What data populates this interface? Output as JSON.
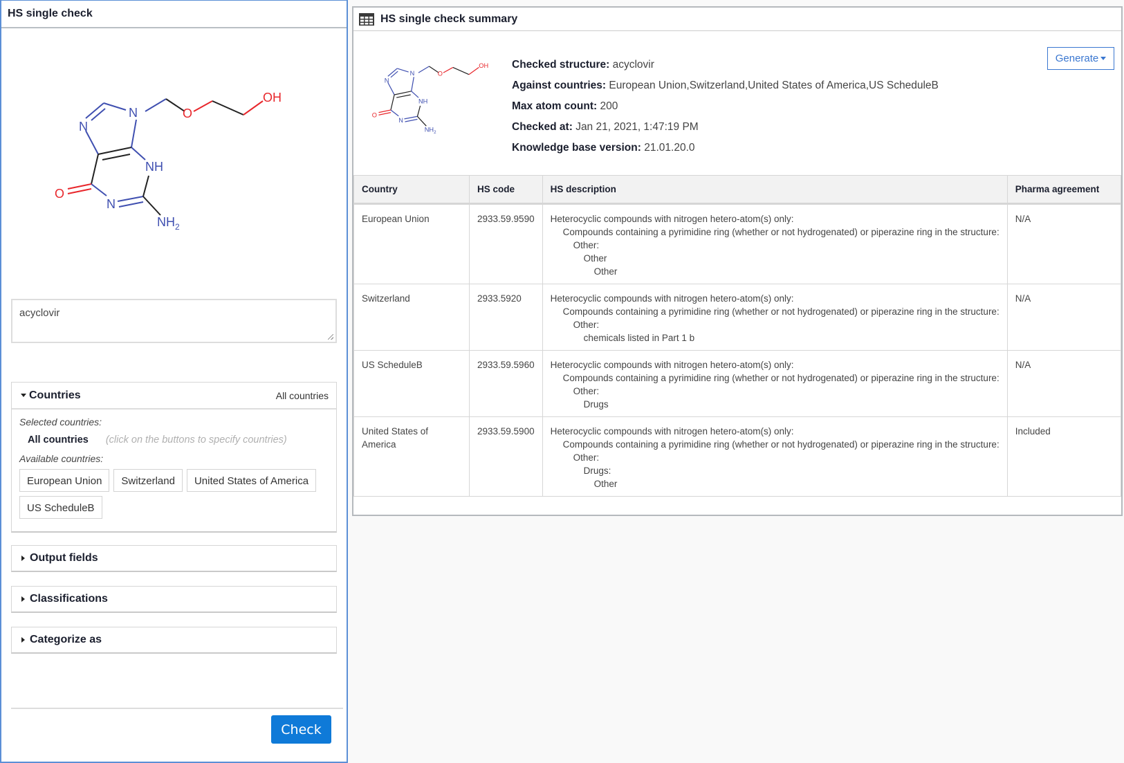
{
  "left_panel": {
    "title": "HS single check",
    "structure_name_input": "acyclovir",
    "countries_section": {
      "title": "Countries",
      "summary": "All countries",
      "selected_label": "Selected countries:",
      "selected_value": "All countries",
      "selected_hint": "(click on the buttons to specify countries)",
      "available_label": "Available countries:",
      "available": [
        "European Union",
        "Switzerland",
        "United States of America",
        "US ScheduleB"
      ]
    },
    "collapsed_sections": [
      "Output fields",
      "Classifications",
      "Categorize as"
    ],
    "check_button": "Check",
    "molecule_labels": {
      "n1": "N",
      "n2": "N",
      "n3": "N",
      "nh": "NH",
      "nh2": "NH",
      "nh2_sub": "2",
      "o_ring": "O",
      "o_ether": "O",
      "oh": "OH"
    }
  },
  "right_panel": {
    "title": "HS single check summary",
    "generate_button": "Generate",
    "summary": {
      "checked_structure_label": "Checked structure:",
      "checked_structure": "acyclovir",
      "against_countries_label": "Against countries:",
      "against_countries": "European Union,Switzerland,United States of America,US ScheduleB",
      "max_atom_count_label": "Max atom count:",
      "max_atom_count": "200",
      "checked_at_label": "Checked at:",
      "checked_at": "Jan 21, 2021, 1:47:19 PM",
      "kb_version_label": "Knowledge base version:",
      "kb_version": "21.01.20.0"
    },
    "table": {
      "headers": [
        "Country",
        "HS code",
        "HS description",
        "Pharma agreement"
      ],
      "rows": [
        {
          "country": "European Union",
          "hs_code": "2933.59.9590",
          "description": [
            "Heterocyclic compounds with nitrogen hetero-atom(s) only:",
            "Compounds containing a pyrimidine ring (whether or not hydrogenated) or piperazine ring in the structure:",
            "Other:",
            "Other",
            "Other"
          ],
          "pharma": "N/A"
        },
        {
          "country": "Switzerland",
          "hs_code": "2933.5920",
          "description": [
            "Heterocyclic compounds with nitrogen hetero-atom(s) only:",
            "Compounds containing a pyrimidine ring (whether or not hydrogenated) or piperazine ring in the structure:",
            "Other:",
            "chemicals listed in Part 1 b"
          ],
          "pharma": "N/A"
        },
        {
          "country": "US ScheduleB",
          "hs_code": "2933.59.5960",
          "description": [
            "Heterocyclic compounds with nitrogen hetero-atom(s) only:",
            "Compounds containing a pyrimidine ring (whether or not hydrogenated) or piperazine ring in the structure:",
            "Other:",
            "Drugs"
          ],
          "pharma": "N/A"
        },
        {
          "country": "United States of America",
          "hs_code": "2933.59.5900",
          "description": [
            "Heterocyclic compounds with nitrogen hetero-atom(s) only:",
            "Compounds containing a pyrimidine ring (whether or not hydrogenated) or piperazine ring in the structure:",
            "Other:",
            "Drugs:",
            "Other"
          ],
          "pharma": "Included"
        }
      ]
    }
  },
  "colors": {
    "primary_button": "#0f7ad8",
    "panel_accent_border": "#5b8fd6",
    "generate_outline": "#3a77d0",
    "atom_nitrogen": "#3f4fb0",
    "atom_oxygen": "#e8262b"
  }
}
